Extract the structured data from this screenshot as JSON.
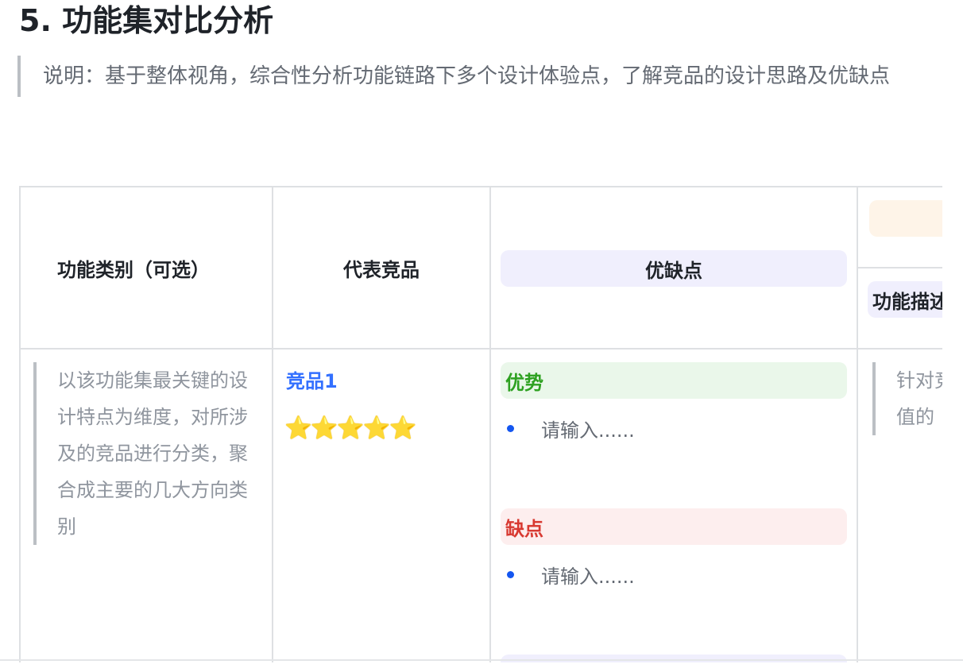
{
  "heading": "5. 功能集对比分析",
  "note": "说明：基于整体视角，综合性分析功能链路下多个设计体验点，了解竞品的设计思路及优缺点",
  "table": {
    "headers": {
      "category": "功能类别（可选）",
      "competitor": "代表竞品",
      "pros_cons": "优缺点",
      "description": "功能描述"
    },
    "row": {
      "category_hint": "以该功能集最关键的设计特点为维度，对所涉及的竞品进行分类，聚合成主要的几大方向类别",
      "competitor_name": "竞品1",
      "rating_stars": "⭐⭐⭐⭐⭐",
      "pros_label": "优势",
      "pros_item": "请输入......",
      "cons_label": "缺点",
      "cons_item": "请输入......",
      "description_hint": "针对竞品进行重点价值的"
    }
  },
  "colors": {
    "link": "#3370ff",
    "pros": "#2ea121",
    "cons": "#d83931",
    "bullet": "#1456f0",
    "star": "#ffc53d"
  }
}
